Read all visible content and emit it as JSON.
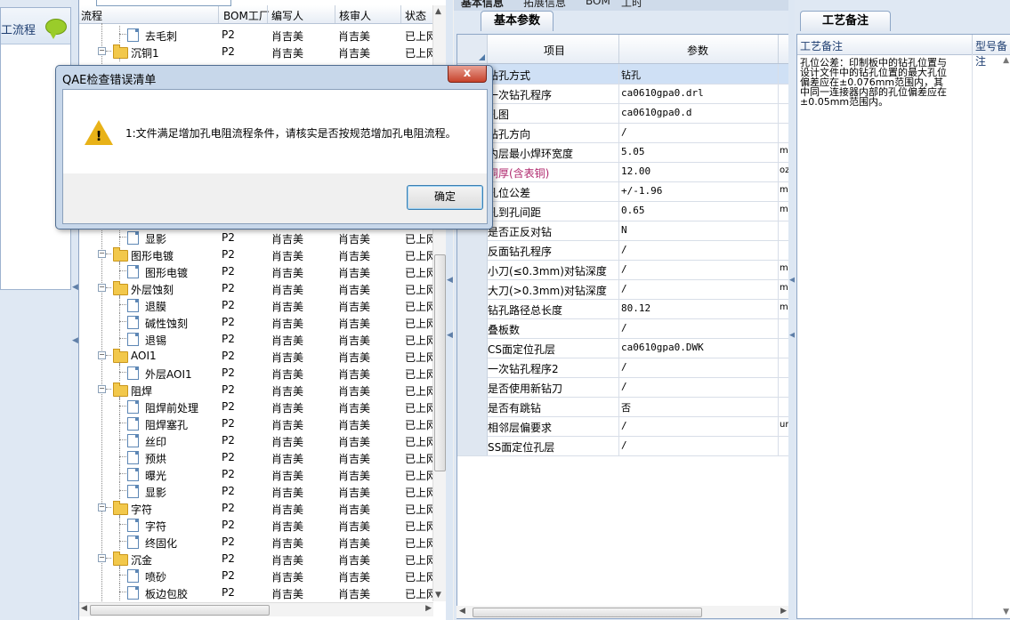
{
  "workflow_panel": {
    "title": "工流程"
  },
  "tree": {
    "headers": [
      "流程",
      "BOM工厂",
      "编写人",
      "核审人",
      "状态"
    ],
    "rows": [
      {
        "name": "去毛刺",
        "bom": "P2",
        "writer": "肖吉美",
        "reviewer": "肖吉美",
        "status": "已上网"
      },
      {
        "name": "沉铜1",
        "bom": "P2",
        "writer": "肖吉美",
        "reviewer": "肖吉美",
        "status": "已上网"
      },
      {
        "name": "显影",
        "bom": "P2",
        "writer": "肖吉美",
        "reviewer": "肖吉美",
        "status": "已上网"
      },
      {
        "name": "图形电镀",
        "bom": "P2",
        "writer": "肖吉美",
        "reviewer": "肖吉美",
        "status": "已上网"
      },
      {
        "name": "图形电镀",
        "bom": "P2",
        "writer": "肖吉美",
        "reviewer": "肖吉美",
        "status": "已上网"
      },
      {
        "name": "外层蚀刻",
        "bom": "P2",
        "writer": "肖吉美",
        "reviewer": "肖吉美",
        "status": "已上网"
      },
      {
        "name": "退膜",
        "bom": "P2",
        "writer": "肖吉美",
        "reviewer": "肖吉美",
        "status": "已上网"
      },
      {
        "name": "碱性蚀刻",
        "bom": "P2",
        "writer": "肖吉美",
        "reviewer": "肖吉美",
        "status": "已上网"
      },
      {
        "name": "退锡",
        "bom": "P2",
        "writer": "肖吉美",
        "reviewer": "肖吉美",
        "status": "已上网"
      },
      {
        "name": "AOI1",
        "bom": "P2",
        "writer": "肖吉美",
        "reviewer": "肖吉美",
        "status": "已上网"
      },
      {
        "name": "外层AOI1",
        "bom": "P2",
        "writer": "肖吉美",
        "reviewer": "肖吉美",
        "status": "已上网"
      },
      {
        "name": "阻焊",
        "bom": "P2",
        "writer": "肖吉美",
        "reviewer": "肖吉美",
        "status": "已上网"
      },
      {
        "name": "阻焊前处理",
        "bom": "P2",
        "writer": "肖吉美",
        "reviewer": "肖吉美",
        "status": "已上网"
      },
      {
        "name": "阻焊塞孔",
        "bom": "P2",
        "writer": "肖吉美",
        "reviewer": "肖吉美",
        "status": "已上网"
      },
      {
        "name": "丝印",
        "bom": "P2",
        "writer": "肖吉美",
        "reviewer": "肖吉美",
        "status": "已上网"
      },
      {
        "name": "预烘",
        "bom": "P2",
        "writer": "肖吉美",
        "reviewer": "肖吉美",
        "status": "已上网"
      },
      {
        "name": "曝光",
        "bom": "P2",
        "writer": "肖吉美",
        "reviewer": "肖吉美",
        "status": "已上网"
      },
      {
        "name": "显影",
        "bom": "P2",
        "writer": "肖吉美",
        "reviewer": "肖吉美",
        "status": "已上网"
      },
      {
        "name": "字符",
        "bom": "P2",
        "writer": "肖吉美",
        "reviewer": "肖吉美",
        "status": "已上网"
      },
      {
        "name": "字符",
        "bom": "P2",
        "writer": "肖吉美",
        "reviewer": "肖吉美",
        "status": "已上网"
      },
      {
        "name": "终固化",
        "bom": "P2",
        "writer": "肖吉美",
        "reviewer": "肖吉美",
        "status": "已上网"
      },
      {
        "name": "沉金",
        "bom": "P2",
        "writer": "肖吉美",
        "reviewer": "肖吉美",
        "status": "已上网"
      },
      {
        "name": "喷砂",
        "bom": "P2",
        "writer": "肖吉美",
        "reviewer": "肖吉美",
        "status": "已上网"
      },
      {
        "name": "板边包胶",
        "bom": "P2",
        "writer": "肖吉美",
        "reviewer": "肖吉美",
        "status": "已上网"
      }
    ]
  },
  "params": {
    "top_tabs": [
      "基本信息",
      "拓展信息",
      "BOM",
      "工时"
    ],
    "tab_label": "基本参数",
    "headers": [
      "项目",
      "参数"
    ],
    "rows": [
      {
        "label": "钻孔方式",
        "value": "钻孔",
        "unit": ""
      },
      {
        "label": "一次钻孔程序",
        "value": "ca0610gpa0.drl",
        "unit": ""
      },
      {
        "label": "孔图",
        "value": "ca0610gpa0.d",
        "unit": ""
      },
      {
        "label": "钻孔方向",
        "value": "/",
        "unit": ""
      },
      {
        "label": "内层最小焊环宽度",
        "value": "5.05",
        "unit": "mil"
      },
      {
        "label": "铜厚(含表铜)",
        "value": "12.00",
        "unit": "oz"
      },
      {
        "label": "孔位公差",
        "value": "+/-1.96",
        "unit": "mil"
      },
      {
        "label": "孔到孔间距",
        "value": "0.65",
        "unit": "mm"
      },
      {
        "label": "是否正反对钻",
        "value": "N",
        "unit": ""
      },
      {
        "label": "反面钻孔程序",
        "value": "/",
        "unit": ""
      },
      {
        "label": "小刀(≤0.3mm)对钻深度",
        "value": "/",
        "unit": "mm"
      },
      {
        "label": "大刀(>0.3mm)对钻深度",
        "value": "/",
        "unit": "mm"
      },
      {
        "label": "钻孔路径总长度",
        "value": "80.12",
        "unit": "m"
      },
      {
        "label": "叠板数",
        "value": "/",
        "unit": ""
      },
      {
        "label": "CS面定位孔层",
        "value": "ca0610gpa0.DWK",
        "unit": ""
      },
      {
        "label": "一次钻孔程序2",
        "value": "/",
        "unit": ""
      },
      {
        "label": "是否使用新钻刀",
        "value": "/",
        "unit": ""
      },
      {
        "label": "是否有跳钻",
        "value": "否",
        "unit": ""
      },
      {
        "label": "相邻层偏要求",
        "value": "/",
        "unit": "um"
      },
      {
        "label": "SS面定位孔层",
        "value": "/",
        "unit": ""
      }
    ]
  },
  "notes": {
    "tab_label": "工艺备注",
    "headers": [
      "工艺备注",
      "型号备注"
    ],
    "text": "孔位公差：印制板中的钻孔位置与设计文件中的钻孔位置的最大孔位偏差应在±0.076mm范围内，其中同一连接器内部的孔位偏差应在±0.05mm范围内。"
  },
  "dialog": {
    "title": "QAE检查错误清单",
    "message": "1:文件满足增加孔电阻流程条件，请核实是否按规范增加孔电阻流程。",
    "ok_label": "确定",
    "close_label": "x"
  },
  "colors": {
    "accent": "#3c7fb1",
    "warning": "#e8b218",
    "highlight_label": "#b0286e",
    "selected_row": "#cfe0f5"
  }
}
